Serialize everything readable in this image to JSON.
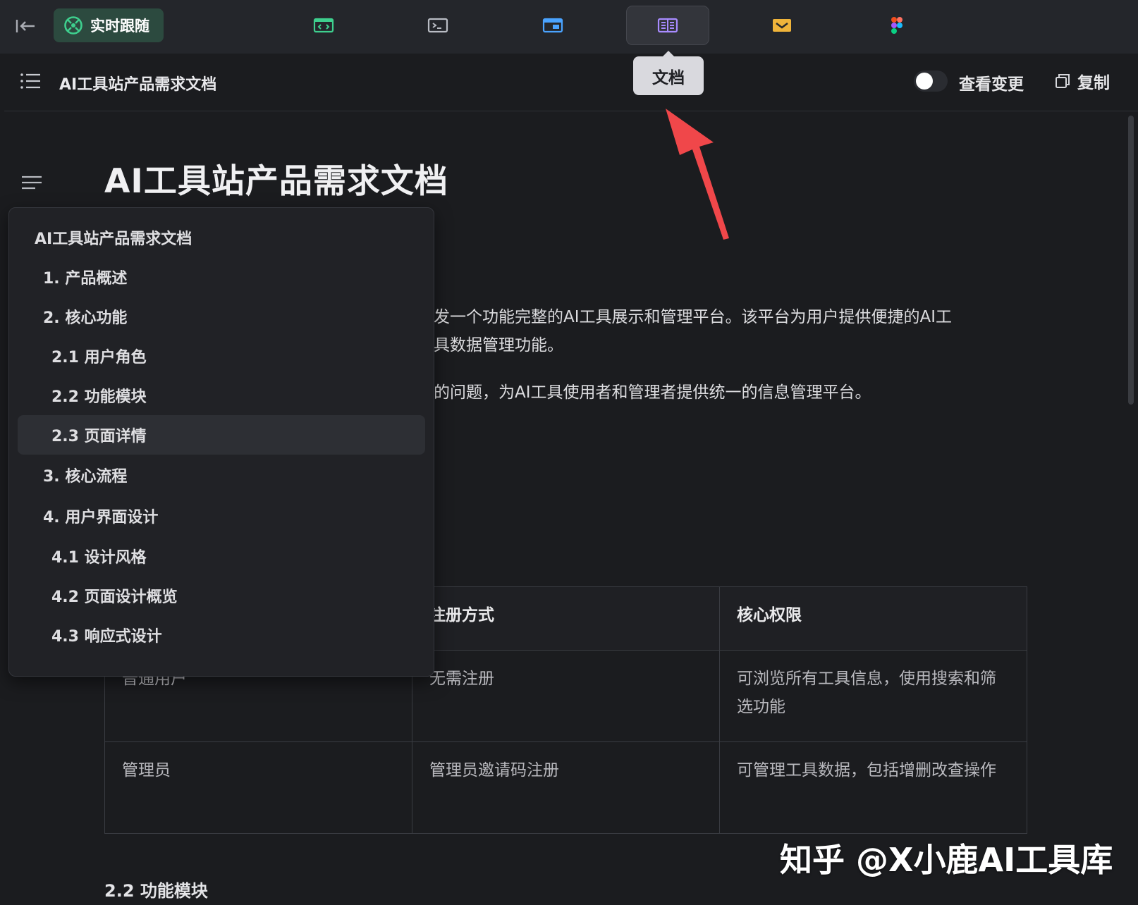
{
  "topbar": {
    "live_follow_label": "实时跟随",
    "tabs": [
      {
        "icon": "code-window-icon",
        "color": "#3ecf8e"
      },
      {
        "icon": "terminal-icon",
        "color": "#b9bcc4"
      },
      {
        "icon": "browser-window-icon",
        "color": "#4aa3ff"
      },
      {
        "icon": "document-icon",
        "color": "#a88bff",
        "active": true
      },
      {
        "icon": "inbox-icon",
        "color": "#f0b43a"
      },
      {
        "icon": "figma-icon",
        "color": "#f24e1e"
      }
    ],
    "tooltip": "文档"
  },
  "doc_header": {
    "title": "AI工具站产品需求文档",
    "view_changes_label": "查看变更",
    "copy_label": "复制"
  },
  "content": {
    "title": "AI工具站产品需求文档",
    "para_1_line_1": "发一个功能完整的AI工具展示和管理平台。该平台为用户提供便捷的AI工",
    "para_1_line_2": "具数据管理功能。",
    "para_2": "的问题，为AI工具使用者和管理者提供统一的信息管理平台。",
    "table": {
      "headers": [
        "",
        "注册方式",
        "核心权限"
      ],
      "rows": [
        [
          "普通用户",
          "无需注册",
          "可浏览所有工具信息，使用搜索和筛选功能"
        ],
        [
          "管理员",
          "管理员邀请码注册",
          "可管理工具数据，包括增删改查操作"
        ]
      ]
    },
    "section_22": "2.2 功能模块"
  },
  "toc": {
    "items": [
      {
        "label": "AI工具站产品需求文档",
        "level": 0
      },
      {
        "label": "1. 产品概述",
        "level": 1
      },
      {
        "label": "2. 核心功能",
        "level": 1
      },
      {
        "label": "2.1 用户角色",
        "level": 2
      },
      {
        "label": "2.2 功能模块",
        "level": 2
      },
      {
        "label": "2.3 页面详情",
        "level": 2,
        "active": true
      },
      {
        "label": "3. 核心流程",
        "level": 1
      },
      {
        "label": "4. 用户界面设计",
        "level": 1
      },
      {
        "label": "4.1 设计风格",
        "level": 2
      },
      {
        "label": "4.2 页面设计概览",
        "level": 2
      },
      {
        "label": "4.3 响应式设计",
        "level": 2
      }
    ]
  },
  "annotation": {
    "arrow_color": "#f0474a"
  },
  "watermark": "知乎 @X小鹿AI工具库"
}
